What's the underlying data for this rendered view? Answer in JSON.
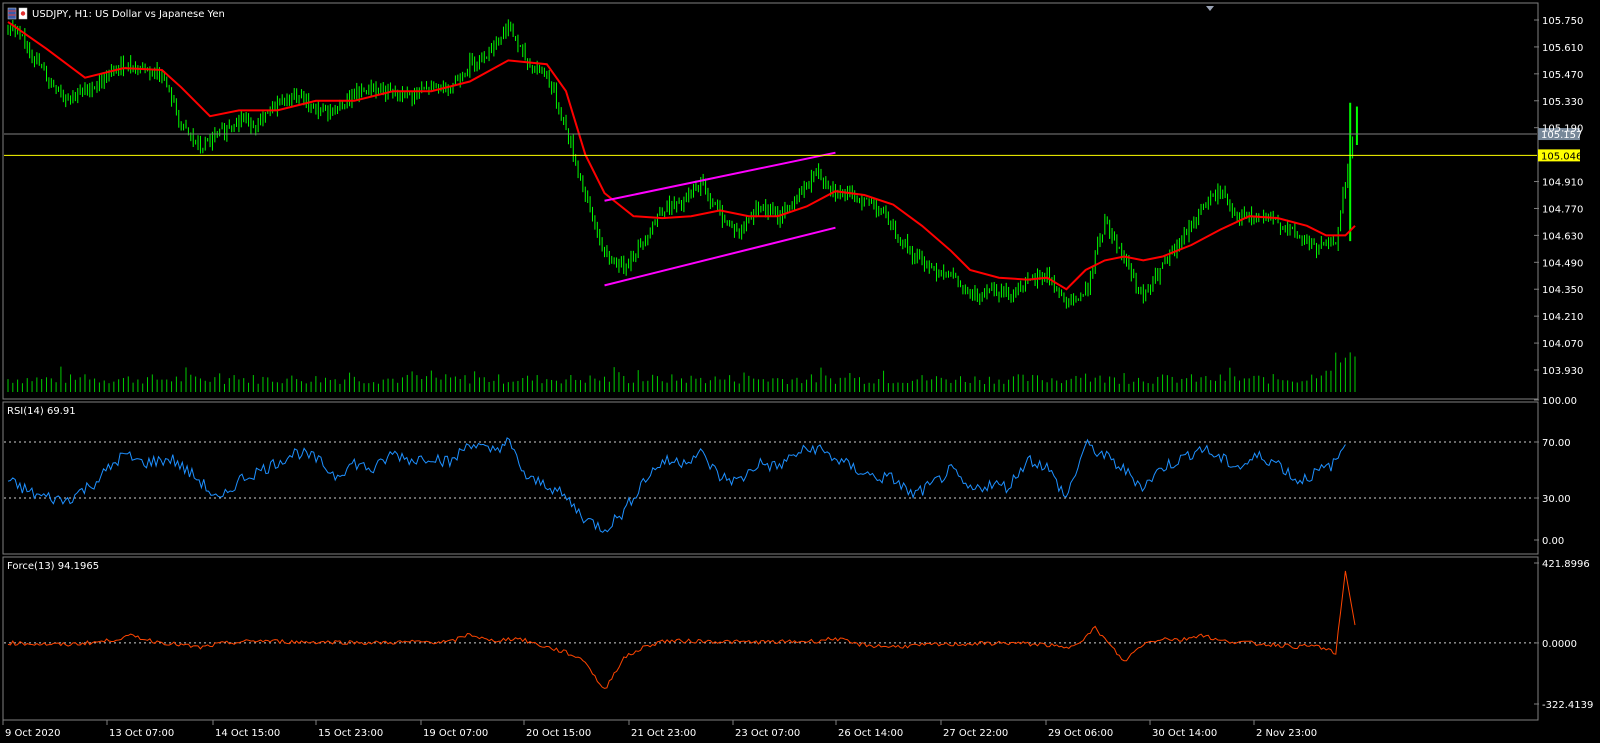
{
  "app": {
    "symbol_title": "USDJPY, H1:  US Dollar vs Japanese Yen",
    "colors": {
      "background": "#000000",
      "frame": "#7f7f7f",
      "candle_up": "#00ff00",
      "ma_line": "#ff0000",
      "channel": "#ff00ff",
      "horizontal_line": "#ffff00",
      "bid_line": "#808080",
      "volume": "#00cc00",
      "rsi_line": "#1e90ff",
      "force_line": "#ff4500",
      "level_dash": "#cfcfcf"
    }
  },
  "chart_data": [
    {
      "type": "candlestick",
      "panel": "main",
      "title": "USDJPY, H1:  US Dollar vs Japanese Yen",
      "y_ticks": [
        "105.750",
        "105.610",
        "105.470",
        "105.330",
        "105.190",
        "104.910",
        "104.770",
        "104.630",
        "104.490",
        "104.350",
        "104.210",
        "104.070",
        "103.930"
      ],
      "ylim": [
        103.89,
        105.83
      ],
      "horizontal_line": 105.046,
      "horizontal_line_label": "105.046",
      "bid_price": 105.157,
      "bid_price_label": "105.157",
      "close_path_keypoints": [
        [
          0,
          105.72
        ],
        [
          2,
          105.62
        ],
        [
          4,
          105.45
        ],
        [
          6,
          105.35
        ],
        [
          8,
          105.38
        ],
        [
          10,
          105.44
        ],
        [
          12,
          105.52
        ],
        [
          14,
          105.5
        ],
        [
          16,
          105.47
        ],
        [
          18,
          105.2
        ],
        [
          20,
          105.08
        ],
        [
          22,
          105.16
        ],
        [
          24,
          105.24
        ],
        [
          26,
          105.2
        ],
        [
          28,
          105.32
        ],
        [
          30,
          105.36
        ],
        [
          32,
          105.28
        ],
        [
          34,
          105.28
        ],
        [
          36,
          105.36
        ],
        [
          38,
          105.4
        ],
        [
          40,
          105.36
        ],
        [
          42,
          105.36
        ],
        [
          44,
          105.4
        ],
        [
          46,
          105.4
        ],
        [
          48,
          105.52
        ],
        [
          50,
          105.59
        ],
        [
          52,
          105.72
        ],
        [
          54,
          105.52
        ],
        [
          56,
          105.47
        ],
        [
          58,
          105.18
        ],
        [
          60,
          104.84
        ],
        [
          62,
          104.52
        ],
        [
          64,
          104.47
        ],
        [
          66,
          104.6
        ],
        [
          68,
          104.77
        ],
        [
          70,
          104.79
        ],
        [
          72,
          104.9
        ],
        [
          74,
          104.74
        ],
        [
          76,
          104.64
        ],
        [
          78,
          104.79
        ],
        [
          80,
          104.72
        ],
        [
          82,
          104.82
        ],
        [
          84,
          104.96
        ],
        [
          86,
          104.86
        ],
        [
          88,
          104.82
        ],
        [
          90,
          104.8
        ],
        [
          92,
          104.67
        ],
        [
          94,
          104.53
        ],
        [
          96,
          104.46
        ],
        [
          98,
          104.43
        ],
        [
          100,
          104.3
        ],
        [
          102,
          104.36
        ],
        [
          104,
          104.33
        ],
        [
          106,
          104.38
        ],
        [
          108,
          104.43
        ],
        [
          110,
          104.27
        ],
        [
          112,
          104.33
        ],
        [
          114,
          104.7
        ],
        [
          116,
          104.52
        ],
        [
          118,
          104.3
        ],
        [
          120,
          104.47
        ],
        [
          122,
          104.6
        ],
        [
          124,
          104.77
        ],
        [
          126,
          104.86
        ],
        [
          128,
          104.72
        ],
        [
          130,
          104.72
        ],
        [
          132,
          104.7
        ],
        [
          134,
          104.63
        ],
        [
          136,
          104.56
        ],
        [
          138,
          104.6
        ],
        [
          139,
          104.9
        ],
        [
          140,
          105.2
        ]
      ],
      "ma_keypoints": [
        [
          0,
          105.74
        ],
        [
          4,
          105.6
        ],
        [
          8,
          105.45
        ],
        [
          12,
          105.5
        ],
        [
          16,
          105.49
        ],
        [
          18,
          105.4
        ],
        [
          21,
          105.25
        ],
        [
          24,
          105.28
        ],
        [
          28,
          105.28
        ],
        [
          32,
          105.33
        ],
        [
          36,
          105.33
        ],
        [
          40,
          105.38
        ],
        [
          44,
          105.38
        ],
        [
          48,
          105.43
        ],
        [
          52,
          105.54
        ],
        [
          56,
          105.52
        ],
        [
          58,
          105.38
        ],
        [
          60,
          105.05
        ],
        [
          62,
          104.85
        ],
        [
          65,
          104.73
        ],
        [
          68,
          104.72
        ],
        [
          71,
          104.73
        ],
        [
          74,
          104.76
        ],
        [
          77,
          104.73
        ],
        [
          80,
          104.73
        ],
        [
          83,
          104.78
        ],
        [
          86,
          104.86
        ],
        [
          89,
          104.84
        ],
        [
          92,
          104.79
        ],
        [
          95,
          104.68
        ],
        [
          98,
          104.55
        ],
        [
          100,
          104.45
        ],
        [
          103,
          104.41
        ],
        [
          106,
          104.4
        ],
        [
          108,
          104.41
        ],
        [
          110,
          104.35
        ],
        [
          112,
          104.45
        ],
        [
          114,
          104.5
        ],
        [
          116,
          104.52
        ],
        [
          118,
          104.5
        ],
        [
          120,
          104.52
        ],
        [
          123,
          104.58
        ],
        [
          126,
          104.66
        ],
        [
          129,
          104.73
        ],
        [
          132,
          104.72
        ],
        [
          135,
          104.68
        ],
        [
          137,
          104.63
        ],
        [
          139,
          104.63
        ],
        [
          140,
          104.68
        ]
      ],
      "channel_lines": [
        {
          "from": [
            62,
            104.81
          ],
          "to": [
            86,
            105.06
          ]
        },
        {
          "from": [
            62,
            104.37
          ],
          "to": [
            86,
            104.67
          ]
        }
      ]
    },
    {
      "type": "line",
      "panel": "rsi",
      "title": "RSI(14) 69.91",
      "y_ticks": [
        "100.00",
        "70.00",
        "30.00",
        "0.00"
      ],
      "ylim": [
        0,
        100
      ],
      "levels": [
        70,
        30
      ],
      "series": [
        {
          "keypoints": [
            [
              0,
              42
            ],
            [
              3,
              32
            ],
            [
              6,
              28
            ],
            [
              9,
              41
            ],
            [
              12,
              61
            ],
            [
              14,
              55
            ],
            [
              17,
              58
            ],
            [
              20,
              42
            ],
            [
              22,
              27
            ],
            [
              24,
              43
            ],
            [
              27,
              52
            ],
            [
              30,
              63
            ],
            [
              32,
              58
            ],
            [
              34,
              46
            ],
            [
              36,
              55
            ],
            [
              38,
              50
            ],
            [
              40,
              62
            ],
            [
              42,
              57
            ],
            [
              44,
              60
            ],
            [
              46,
              55
            ],
            [
              48,
              70
            ],
            [
              50,
              63
            ],
            [
              52,
              70
            ],
            [
              54,
              43
            ],
            [
              56,
              40
            ],
            [
              58,
              30
            ],
            [
              60,
              15
            ],
            [
              62,
              8
            ],
            [
              64,
              20
            ],
            [
              66,
              42
            ],
            [
              68,
              56
            ],
            [
              70,
              56
            ],
            [
              72,
              62
            ],
            [
              74,
              45
            ],
            [
              76,
              42
            ],
            [
              78,
              55
            ],
            [
              80,
              52
            ],
            [
              82,
              62
            ],
            [
              84,
              66
            ],
            [
              86,
              58
            ],
            [
              88,
              51
            ],
            [
              90,
              45
            ],
            [
              92,
              44
            ],
            [
              94,
              32
            ],
            [
              96,
              39
            ],
            [
              98,
              50
            ],
            [
              100,
              35
            ],
            [
              102,
              40
            ],
            [
              104,
              38
            ],
            [
              106,
              58
            ],
            [
              108,
              52
            ],
            [
              110,
              30
            ],
            [
              112,
              68
            ],
            [
              114,
              60
            ],
            [
              116,
              50
            ],
            [
              118,
              38
            ],
            [
              120,
              52
            ],
            [
              122,
              58
            ],
            [
              124,
              66
            ],
            [
              126,
              58
            ],
            [
              128,
              52
            ],
            [
              130,
              60
            ],
            [
              132,
              55
            ],
            [
              134,
              42
            ],
            [
              136,
              48
            ],
            [
              138,
              55
            ],
            [
              139,
              69.91
            ]
          ]
        }
      ]
    },
    {
      "type": "line",
      "panel": "force",
      "title": "Force(13) 94.1965",
      "y_ticks": [
        "421.8996",
        "0.0000",
        "-322.4139"
      ],
      "ylim": [
        -322.4139,
        421.8996
      ],
      "levels": [
        0
      ],
      "series": [
        {
          "keypoints": [
            [
              0,
              0
            ],
            [
              6,
              -10
            ],
            [
              10,
              8
            ],
            [
              13,
              38
            ],
            [
              15,
              10
            ],
            [
              20,
              -25
            ],
            [
              22,
              -5
            ],
            [
              26,
              12
            ],
            [
              30,
              5
            ],
            [
              34,
              5
            ],
            [
              38,
              0
            ],
            [
              42,
              5
            ],
            [
              46,
              5
            ],
            [
              48,
              48
            ],
            [
              50,
              10
            ],
            [
              53,
              25
            ],
            [
              55,
              -8
            ],
            [
              58,
              -50
            ],
            [
              60,
              -95
            ],
            [
              61,
              -180
            ],
            [
              62,
              -250
            ],
            [
              63,
              -160
            ],
            [
              64,
              -80
            ],
            [
              66,
              -25
            ],
            [
              68,
              10
            ],
            [
              72,
              10
            ],
            [
              76,
              5
            ],
            [
              80,
              5
            ],
            [
              84,
              10
            ],
            [
              86,
              25
            ],
            [
              88,
              -5
            ],
            [
              90,
              -15
            ],
            [
              92,
              -20
            ],
            [
              96,
              -10
            ],
            [
              100,
              -5
            ],
            [
              104,
              0
            ],
            [
              108,
              -10
            ],
            [
              110,
              -30
            ],
            [
              112,
              30
            ],
            [
              113,
              80
            ],
            [
              114,
              20
            ],
            [
              116,
              -100
            ],
            [
              117,
              -50
            ],
            [
              118,
              -5
            ],
            [
              120,
              25
            ],
            [
              122,
              15
            ],
            [
              124,
              45
            ],
            [
              126,
              10
            ],
            [
              128,
              5
            ],
            [
              130,
              -5
            ],
            [
              132,
              -10
            ],
            [
              134,
              -20
            ],
            [
              136,
              -15
            ],
            [
              138,
              -55
            ],
            [
              139,
              380
            ],
            [
              140,
              94.1965
            ]
          ]
        }
      ]
    }
  ],
  "x_axis": {
    "labels": [
      "9 Oct 2020",
      "13 Oct 07:00",
      "14 Oct 15:00",
      "15 Oct 23:00",
      "19 Oct 07:00",
      "20 Oct 15:00",
      "21 Oct 23:00",
      "23 Oct 07:00",
      "26 Oct 14:00",
      "27 Oct 22:00",
      "29 Oct 06:00",
      "30 Oct 14:00",
      "2 Nov 23:00"
    ]
  }
}
